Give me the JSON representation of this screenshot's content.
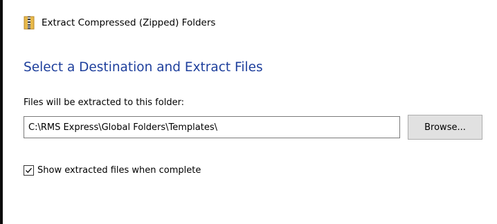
{
  "window": {
    "title": "Extract Compressed (Zipped) Folders",
    "title_icon": "zip-folder-icon"
  },
  "main": {
    "heading": "Select a Destination and Extract Files",
    "path_label": "Files will be extracted to this folder:",
    "path_value": "C:\\RMS Express\\Global Folders\\Templates\\",
    "browse_label": "Browse...",
    "show_files_label": "Show extracted files when complete",
    "show_files_checked": true
  },
  "colors": {
    "heading": "#1e3f9c",
    "button_bg": "#e1e1e1",
    "input_border": "#7a7a7a"
  }
}
